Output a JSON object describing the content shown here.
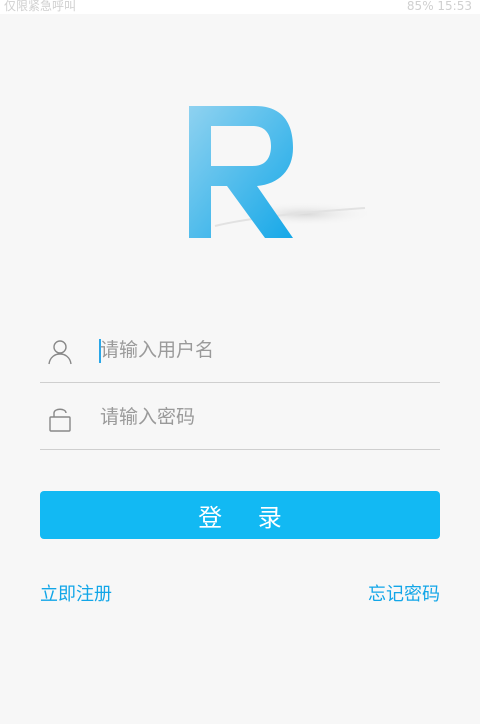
{
  "status_bar": {
    "left_text": "仅限紧急呼叫",
    "right_text": "85% 15:53"
  },
  "login": {
    "username_placeholder": "请输入用户名",
    "password_placeholder": "请输入密码",
    "login_button": "登 录",
    "register_link": "立即注册",
    "forgot_link": "忘记密码"
  },
  "colors": {
    "primary": "#12b9f3",
    "link": "#12a6e8",
    "background": "#f7f7f7"
  },
  "icons": {
    "user": "user-icon",
    "lock": "lock-icon",
    "logo": "logo-r"
  }
}
